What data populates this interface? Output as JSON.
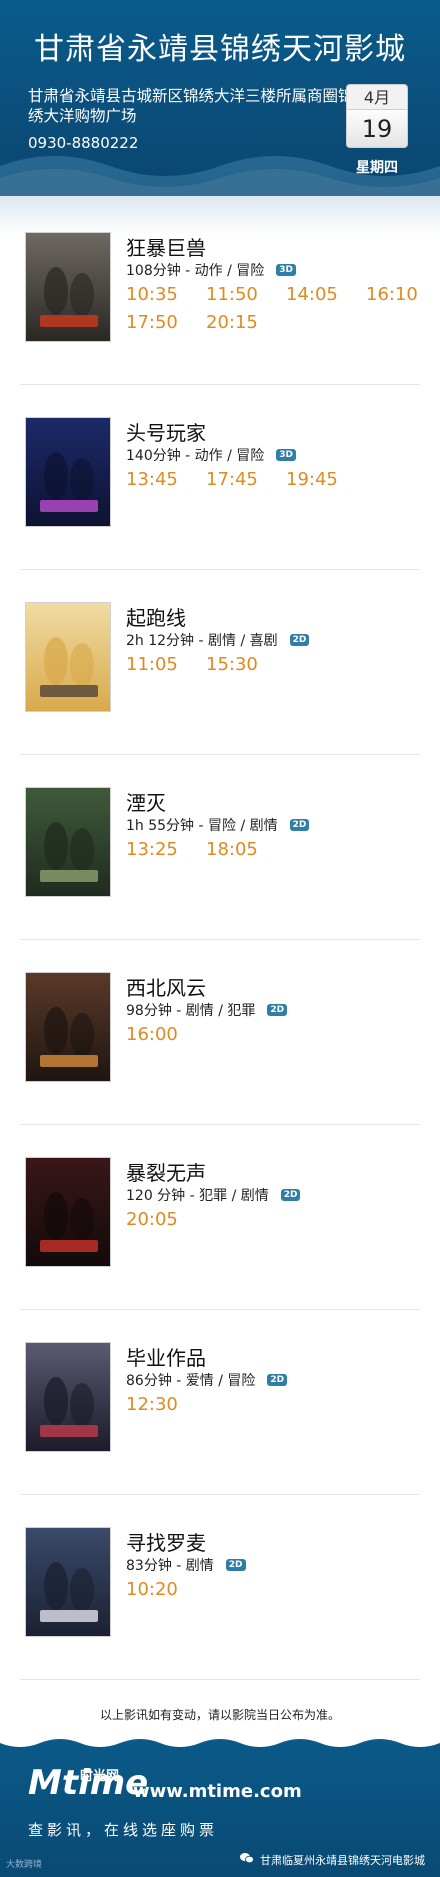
{
  "header": {
    "cinema_name": "甘肃省永靖县锦绣天河影城",
    "address": "甘肃省永靖县古城新区锦绣大洋三楼所属商圈锦绣大洋购物广场",
    "phone": "0930-8880222",
    "date": {
      "month": "4月",
      "day": "19",
      "weekday": "星期四"
    }
  },
  "movies": [
    {
      "title": "狂暴巨兽",
      "info": "108分钟 - 动作 / 冒险",
      "format": "3D",
      "times": [
        "10:35",
        "11:50",
        "14:05",
        "16:10",
        "17:50",
        "20:15"
      ],
      "poster_colors": [
        "#6e6a62",
        "#2a2622",
        "#c33a1c"
      ]
    },
    {
      "title": "头号玩家",
      "info": "140分钟 - 动作 / 冒险",
      "format": "3D",
      "times": [
        "13:45",
        "17:45",
        "19:45"
      ],
      "poster_colors": [
        "#1d2a6a",
        "#0c1230",
        "#b04ac6"
      ]
    },
    {
      "title": "起跑线",
      "info": "2h 12分钟 - 剧情 / 喜剧",
      "format": "2D",
      "times": [
        "11:05",
        "15:30"
      ],
      "poster_colors": [
        "#f0dca4",
        "#d9a84a",
        "#5a4a3a"
      ]
    },
    {
      "title": "湮灭",
      "info": "1h 55分钟 - 冒险 / 剧情",
      "format": "2D",
      "times": [
        "13:25",
        "18:05"
      ],
      "poster_colors": [
        "#3f5a3a",
        "#1f2a1e",
        "#8a9a6a"
      ]
    },
    {
      "title": "西北风云",
      "info": "98分钟 - 剧情 / 犯罪",
      "format": "2D",
      "times": [
        "16:00"
      ],
      "poster_colors": [
        "#5a3a2a",
        "#1e1410",
        "#c9863a"
      ]
    },
    {
      "title": "暴裂无声",
      "info": "120 分钟 - 犯罪 / 剧情",
      "format": "2D",
      "times": [
        "20:05"
      ],
      "poster_colors": [
        "#3a1618",
        "#120a0a",
        "#c0302a"
      ]
    },
    {
      "title": "毕业作品",
      "info": "86分钟 - 爱情 / 冒险",
      "format": "2D",
      "times": [
        "12:30"
      ],
      "poster_colors": [
        "#5a5a72",
        "#1a1a2a",
        "#b83a48"
      ]
    },
    {
      "title": "寻找罗麦",
      "info": "83分钟 - 剧情",
      "format": "2D",
      "times": [
        "10:20"
      ],
      "poster_colors": [
        "#3a4a6a",
        "#1a2030",
        "#d8d8e0"
      ]
    }
  ],
  "notice": "以上影讯如有变动，请以影院当日公布为准。",
  "footer": {
    "logo_text": "Mtime",
    "logo_cn": "时光网",
    "website": "www.mtime.com",
    "slogan": "查影讯，在线选座购票",
    "wechat_account": "甘肃临夏州永靖县锦绣天河电影城",
    "watermark": "大数跨境"
  },
  "colors": {
    "header_blue": "#0b4f7c",
    "showtime_orange": "#e28a22",
    "badge_blue": "#2f7ea6"
  }
}
